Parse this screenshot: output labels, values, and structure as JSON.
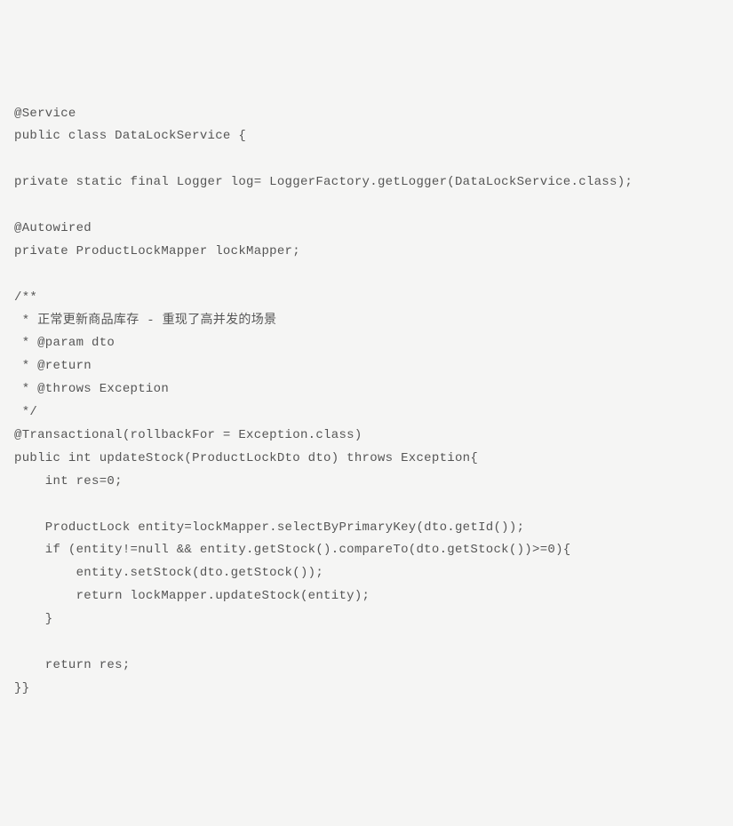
{
  "code": {
    "lines": [
      "@Service",
      "public class DataLockService {",
      "",
      "private static final Logger log= LoggerFactory.getLogger(DataLockService.class);",
      "",
      "@Autowired",
      "private ProductLockMapper lockMapper;",
      "",
      "/**",
      " * 正常更新商品库存 - 重现了高并发的场景",
      " * @param dto",
      " * @return",
      " * @throws Exception",
      " */",
      "@Transactional(rollbackFor = Exception.class)",
      "public int updateStock(ProductLockDto dto) throws Exception{",
      "    int res=0;",
      "",
      "    ProductLock entity=lockMapper.selectByPrimaryKey(dto.getId());",
      "    if (entity!=null && entity.getStock().compareTo(dto.getStock())>=0){",
      "        entity.setStock(dto.getStock());",
      "        return lockMapper.updateStock(entity);",
      "    }",
      "",
      "    return res;",
      "}}"
    ]
  }
}
